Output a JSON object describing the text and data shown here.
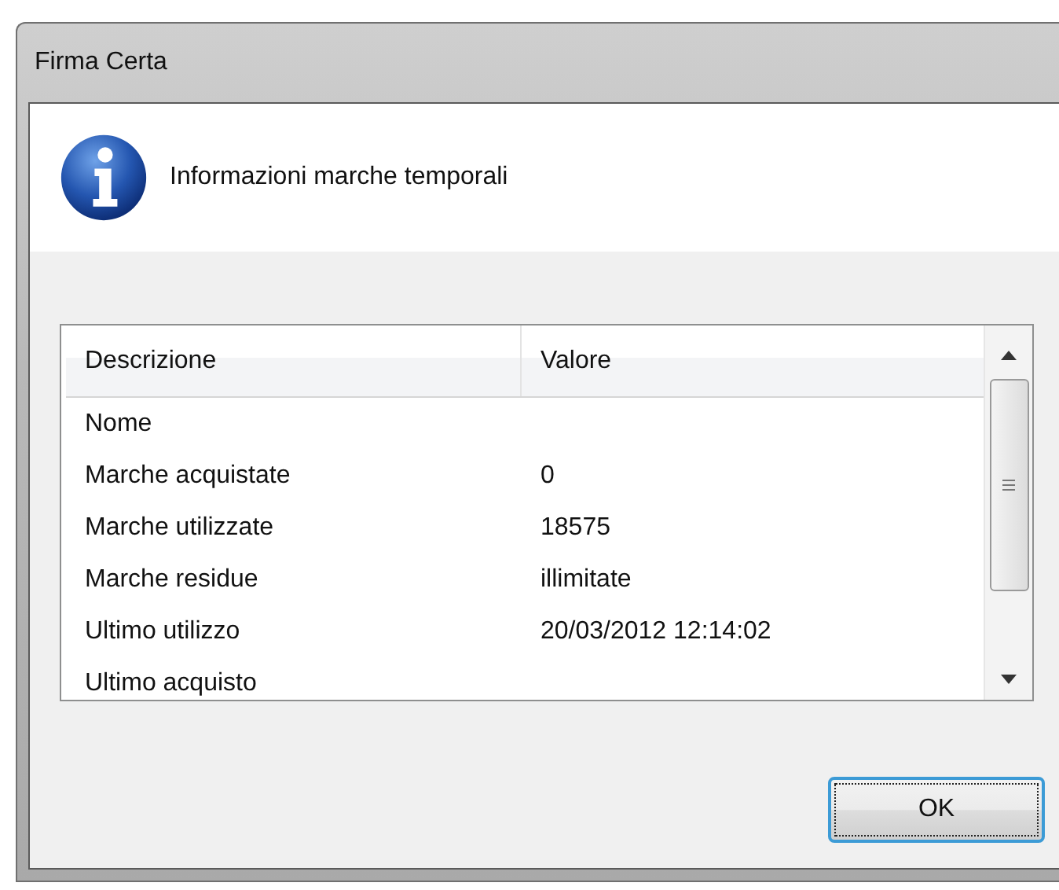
{
  "window": {
    "title": "Firma Certa"
  },
  "header": {
    "text": "Informazioni marche temporali"
  },
  "table": {
    "columns": [
      "Descrizione",
      "Valore"
    ],
    "rows": [
      {
        "description": "Nome",
        "value": ""
      },
      {
        "description": "Marche acquistate",
        "value": "0"
      },
      {
        "description": "Marche utilizzate",
        "value": "18575"
      },
      {
        "description": "Marche residue",
        "value": "illimitate"
      },
      {
        "description": "Ultimo utilizzo",
        "value": "20/03/2012 12:14:02"
      },
      {
        "description": "Ultimo acquisto",
        "value": ""
      }
    ]
  },
  "buttons": [
    {
      "label": "OK",
      "focused": true
    }
  ]
}
